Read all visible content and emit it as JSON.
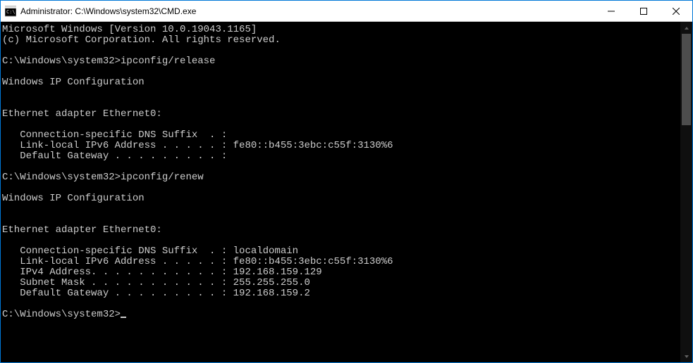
{
  "window": {
    "title": "Administrator: C:\\Windows\\system32\\CMD.exe"
  },
  "terminal": {
    "lines": [
      "Microsoft Windows [Version 10.0.19043.1165]",
      "(c) Microsoft Corporation. All rights reserved.",
      "",
      "C:\\Windows\\system32>ipconfig/release",
      "",
      "Windows IP Configuration",
      "",
      "",
      "Ethernet adapter Ethernet0:",
      "",
      "   Connection-specific DNS Suffix  . :",
      "   Link-local IPv6 Address . . . . . : fe80::b455:3ebc:c55f:3130%6",
      "   Default Gateway . . . . . . . . . :",
      "",
      "C:\\Windows\\system32>ipconfig/renew",
      "",
      "Windows IP Configuration",
      "",
      "",
      "Ethernet adapter Ethernet0:",
      "",
      "   Connection-specific DNS Suffix  . : localdomain",
      "   Link-local IPv6 Address . . . . . : fe80::b455:3ebc:c55f:3130%6",
      "   IPv4 Address. . . . . . . . . . . : 192.168.159.129",
      "   Subnet Mask . . . . . . . . . . . : 255.255.255.0",
      "   Default Gateway . . . . . . . . . : 192.168.159.2",
      ""
    ],
    "prompt": "C:\\Windows\\system32>"
  }
}
